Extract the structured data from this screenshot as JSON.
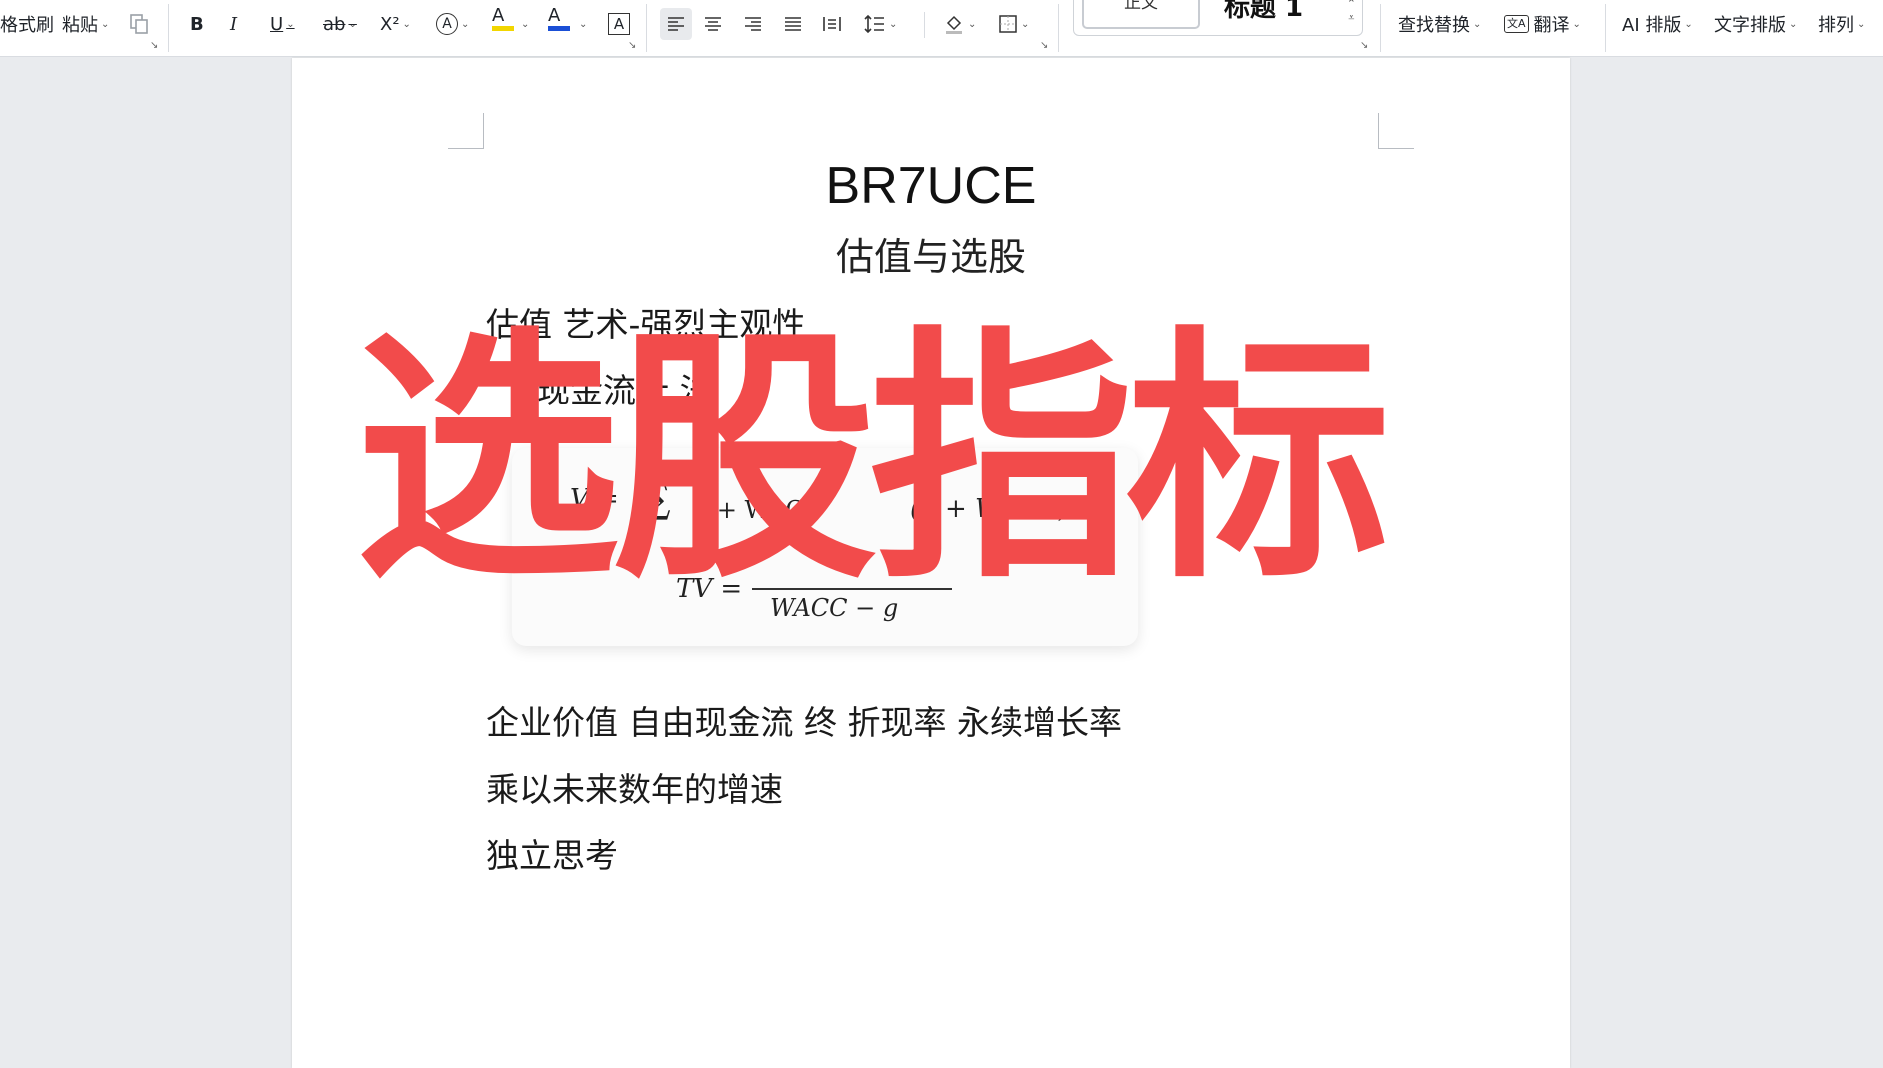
{
  "toolbar": {
    "format_painter": "格式刷",
    "paste": "粘贴",
    "bold": "B",
    "italic": "I",
    "underline": "U",
    "strikethrough": "ab",
    "superscript": "X²",
    "font_effect": "A",
    "highlight": "A",
    "font_color": "A",
    "char_border": "A",
    "style_normal": "正文",
    "style_heading1": "标题 1",
    "find_replace": "查找替换",
    "translate": "翻译",
    "ai_layout": "AI 排版",
    "text_layout": "文字排版",
    "arrange": "排列",
    "colors": {
      "highlight": "#f2d600",
      "font_color": "#1a4fd6"
    }
  },
  "document": {
    "title": "BR7UCE",
    "subtitle": "估值与选股",
    "line1": "估值 艺术-强烈主观性",
    "line2": "现金流计 法",
    "formula1_lhs": "V =",
    "formula1_rhs": "(1 + WACC)ⁿ",
    "formula1_mid": "1 + WACC",
    "formula2_lhs": "TV =",
    "formula2_den": "WACC − g",
    "line3": "企业价值  自由现金流  终  折现率  永续增长率",
    "line4": "乘以未来数年的增速",
    "line5": "独立思考"
  },
  "overlay": {
    "text": "选股指标",
    "color": "#f24b4b"
  }
}
